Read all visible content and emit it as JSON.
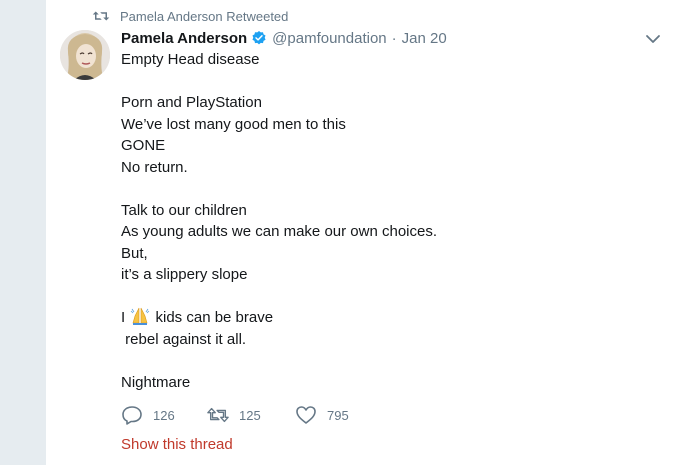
{
  "retweet_context": {
    "icon": "retweet-icon",
    "text": "Pamela Anderson Retweeted"
  },
  "tweet": {
    "author_name": "Pamela Anderson",
    "verified_icon": "verified-badge-icon",
    "handle": "@pamfoundation",
    "separator": "·",
    "date": "Jan 20",
    "menu_icon": "chevron-down-icon",
    "lines": {
      "l1": "Empty Head disease",
      "l2": "Porn and PlayStation",
      "l3": "We’ve lost many good men to this",
      "l4": "GONE",
      "l5": "No return.",
      "l6": "Talk to our children",
      "l7": "As young adults we can make our own choices.",
      "l8": "But,",
      "l9": "it’s a slippery slope",
      "l10_prefix": "I ",
      "l10_emoji": "folded-hands-emoji",
      "l10_suffix": " kids can be brave",
      "l11": " rebel against it all.",
      "l12": "Nightmare"
    }
  },
  "actions": {
    "reply": {
      "icon": "reply-icon",
      "count": "126"
    },
    "retweet": {
      "icon": "retweet-icon",
      "count": "125"
    },
    "like": {
      "icon": "heart-icon",
      "count": "795"
    }
  },
  "show_thread": "Show this thread",
  "colors": {
    "background": "#e6ecf0",
    "card": "#ffffff",
    "secondary_text": "#657786",
    "verified_blue": "#1da1f2",
    "thread_link": "#c0392b"
  }
}
